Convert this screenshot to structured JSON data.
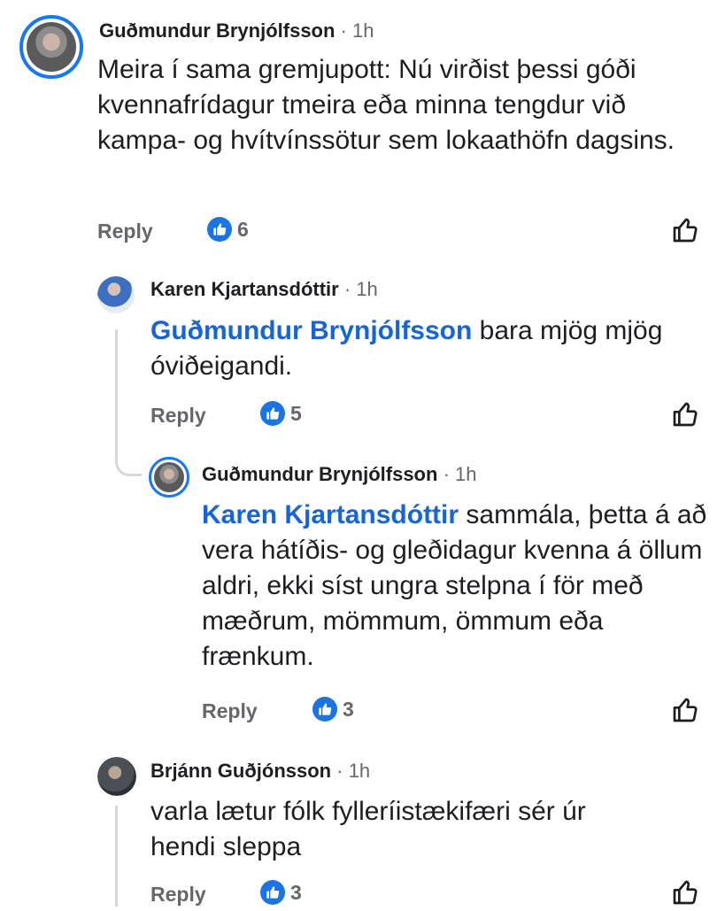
{
  "ui": {
    "reply_label": "Reply",
    "separator": " · "
  },
  "comments": [
    {
      "author": "Guðmundur Brynjólfsson",
      "time": "1h",
      "mention": "",
      "text": "Meira í sama gremjupott: Nú virðist þessi góði kvennafrídagur tmeira eða minna tengdur við kampa- og hvítvínssötur sem lokaathöfn dagsins.",
      "likes": "6"
    },
    {
      "author": "Karen Kjartansdóttir",
      "time": "1h",
      "mention": "Guðmundur Brynjólfsson",
      "text": " bara mjög mjög óviðeigandi.",
      "likes": "5"
    },
    {
      "author": "Guðmundur Brynjólfsson",
      "time": "1h",
      "mention": "Karen Kjartansdóttir",
      "text": " sammála, þetta á að vera hátíðis- og gleðidagur kvenna á öllum aldri, ekki síst ungra stelpna í för með mæðrum, mömmum, ömmum eða frænkum.",
      "likes": "3"
    },
    {
      "author": "Brjánn Guðjónsson",
      "time": "1h",
      "mention": "",
      "text": "varla lætur fólk fylleríistækifæri sér úr hendi sleppa",
      "likes": "3"
    }
  ],
  "colors": {
    "mention": "#1565d8",
    "like_badge": "#1b74e4",
    "muted": "#65676b",
    "avatar_ring": "#1877f2"
  },
  "icons": {
    "like_badge": "thumbs-up-icon",
    "like_button": "thumbs-up-outline-icon"
  }
}
